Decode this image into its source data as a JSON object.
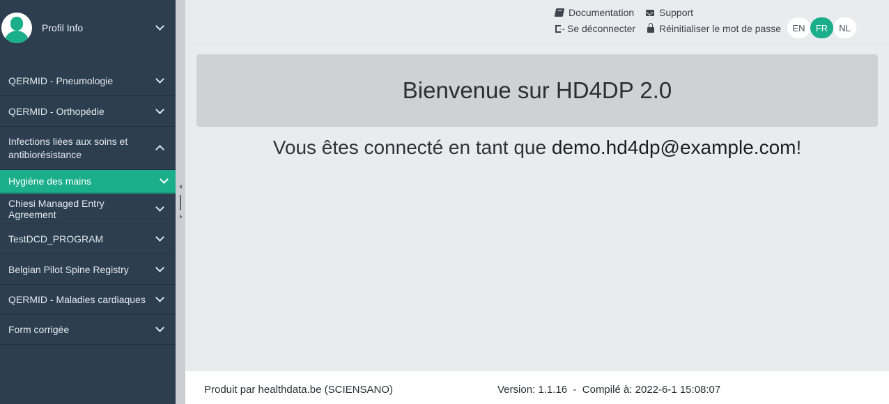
{
  "sidebar": {
    "profile_label": "Profil Info",
    "items": [
      {
        "label": "QERMID - Pneumologie",
        "expanded": false,
        "active": false
      },
      {
        "label": "QERMID - Orthopédie",
        "expanded": false,
        "active": false
      },
      {
        "label": "Infections liées aux soins et antibiorésistance",
        "expanded": true,
        "active": false
      },
      {
        "label": "Hygiène des mains",
        "expanded": false,
        "active": true
      },
      {
        "label": "Chiesi Managed Entry Agreement",
        "expanded": false,
        "active": false
      },
      {
        "label": "TestDCD_PROGRAM",
        "expanded": false,
        "active": false
      },
      {
        "label": "Belgian Pilot Spine Registry",
        "expanded": false,
        "active": false
      },
      {
        "label": "QERMID - Maladies cardiaques",
        "expanded": false,
        "active": false
      },
      {
        "label": "Form corrigée",
        "expanded": false,
        "active": false
      }
    ]
  },
  "topbar": {
    "documentation": "Documentation",
    "support": "Support",
    "logout": "Se déconnecter",
    "reset_password": "Réinitialiser le mot de passe",
    "languages": [
      "EN",
      "FR",
      "NL"
    ],
    "active_language": "FR"
  },
  "main": {
    "title": "Bienvenue sur HD4DP 2.0",
    "welcome_prefix": "Vous êtes connecté en tant que ",
    "user": "demo.hd4dp@example.com",
    "welcome_suffix": "!"
  },
  "footer": {
    "produced_by": "Produit par healthdata.be (SCIENSANO)",
    "version_label": "Version: 1.1.16",
    "separator": "-",
    "compiled_label": "Compilé à: 2022-6-1 15:08:07"
  },
  "colors": {
    "sidebar": "#2d3e50",
    "accent": "#1bae8a",
    "background": "#e9ecef"
  }
}
